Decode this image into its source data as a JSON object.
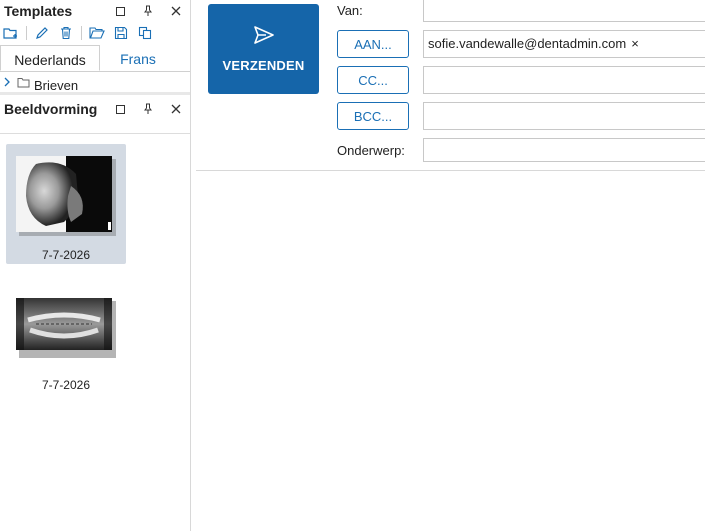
{
  "templates_panel": {
    "title": "Templates",
    "tabs": [
      {
        "label": "Nederlands",
        "active": true
      },
      {
        "label": "Frans",
        "active": false
      }
    ],
    "tree_items": [
      {
        "label": "Brieven",
        "expanded": false
      }
    ]
  },
  "beeldvorming_panel": {
    "title": "Beeldvorming",
    "thumbnails": [
      {
        "date": "7-7-2026",
        "kind": "lateral skull x-ray",
        "selected": true
      },
      {
        "date": "7-7-2026",
        "kind": "panoramic dental x-ray",
        "selected": false
      }
    ]
  },
  "header_icons": {
    "restore": "restore-icon",
    "pin": "pin-icon",
    "close": "close-icon"
  },
  "toolbar_icons": [
    "new-template-icon",
    "edit-icon",
    "delete-icon",
    "open-folder-icon",
    "save-icon",
    "copy-icon"
  ],
  "email": {
    "send_label": "VERZENDEN",
    "from_label": "Van:",
    "from_value": "",
    "to_button": "AAN...",
    "to_recipients": [
      {
        "address": "sofie.vandewalle@dentadmin.com",
        "remove": "×"
      }
    ],
    "cc_button": "CC...",
    "bcc_button": "BCC...",
    "subject_label": "Onderwerp:",
    "subject_value": ""
  },
  "colors": {
    "accent": "#1565a9",
    "link": "#1a6fb5",
    "selection": "#d3dae3"
  }
}
